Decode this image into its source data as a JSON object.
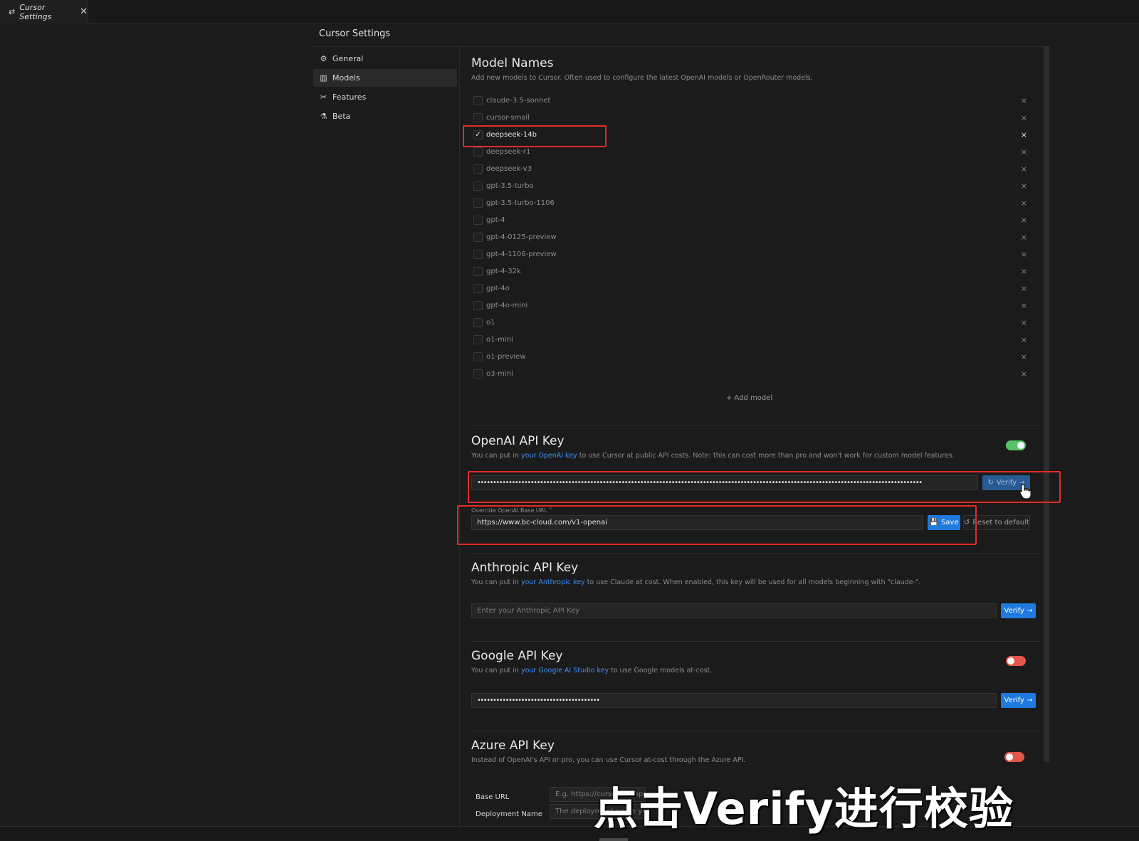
{
  "tab": {
    "icon": "settings-sliders-icon",
    "label": "Cursor Settings",
    "close": "✕"
  },
  "settings_title": "Cursor Settings",
  "sidebar": {
    "items": [
      {
        "label": "General",
        "icon": "gear-icon",
        "glyph": "⚙"
      },
      {
        "label": "Models",
        "icon": "bar-chart-icon",
        "glyph": "▥"
      },
      {
        "label": "Features",
        "icon": "tools-icon",
        "glyph": "✂"
      },
      {
        "label": "Beta",
        "icon": "flask-icon",
        "glyph": "⚗"
      }
    ],
    "active": "Models"
  },
  "model_names": {
    "title": "Model Names",
    "description": "Add new models to Cursor. Often used to configure the latest OpenAI models or OpenRouter models.",
    "models": [
      {
        "name": "claude-3.5-sonnet",
        "checked": false
      },
      {
        "name": "cursor-small",
        "checked": false
      },
      {
        "name": "deepseek-14b",
        "checked": true
      },
      {
        "name": "deepseek-r1",
        "checked": false
      },
      {
        "name": "deepseek-v3",
        "checked": false
      },
      {
        "name": "gpt-3.5-turbo",
        "checked": false
      },
      {
        "name": "gpt-3.5-turbo-1106",
        "checked": false
      },
      {
        "name": "gpt-4",
        "checked": false
      },
      {
        "name": "gpt-4-0125-preview",
        "checked": false
      },
      {
        "name": "gpt-4-1106-preview",
        "checked": false
      },
      {
        "name": "gpt-4-32k",
        "checked": false
      },
      {
        "name": "gpt-4o",
        "checked": false
      },
      {
        "name": "gpt-4o-mini",
        "checked": false
      },
      {
        "name": "o1",
        "checked": false
      },
      {
        "name": "o1-mini",
        "checked": false
      },
      {
        "name": "o1-preview",
        "checked": false
      },
      {
        "name": "o3-mini",
        "checked": false
      }
    ],
    "remove_glyph": "×",
    "add_model_label": "+ Add model"
  },
  "openai": {
    "title": "OpenAI API Key",
    "desc_before": "You can put in ",
    "desc_link": "your OpenAI key",
    "desc_after": " to use Cursor at public API costs. Note: this can cost more than pro and won't work for custom model features.",
    "enabled": true,
    "key_value": "••••••••••••••••••••••••••••••••••••••••••••••••••••••••••••••••••••••••••••••••••••••••••••••••••••••••••••••••••••••••••••••••••••••••••••••",
    "verify_label": "Verify →",
    "override_label": "Override OpenAI Base URL ˅",
    "base_url": "https://www.bc-cloud.com/v1-openai",
    "save_label": "Save",
    "reset_label": "Reset to default"
  },
  "anthropic": {
    "title": "Anthropic API Key",
    "desc_before": "You can put in ",
    "desc_link": "your Anthropic key",
    "desc_after": " to use Claude at cost. When enabled, this key will be used for all models beginning with \"claude-\".",
    "placeholder": "Enter your Anthropic API Key",
    "verify_label": "Verify →"
  },
  "google": {
    "title": "Google API Key",
    "desc_before": "You can put in ",
    "desc_link": "your Google AI Studio key",
    "desc_after": " to use Google models at-cost.",
    "enabled": false,
    "key_value": "•••••••••••••••••••••••••••••••••••••••",
    "verify_label": "Verify →"
  },
  "azure": {
    "title": "Azure API Key",
    "description": "Instead of OpenAI's API or pro, you can use Cursor at-cost through the Azure API.",
    "enabled": false,
    "base_url_label": "Base URL",
    "base_url_placeholder": "E.g. https://cursor-oai.open",
    "deployment_label": "Deployment Name",
    "deployment_placeholder": "The deployment name you"
  },
  "caption": "点击Verify进行校验",
  "colors": {
    "accent": "#1f7ae0",
    "toggle_on": "#58c267",
    "toggle_off": "#e2564b",
    "highlight_box": "#e12b2b"
  }
}
